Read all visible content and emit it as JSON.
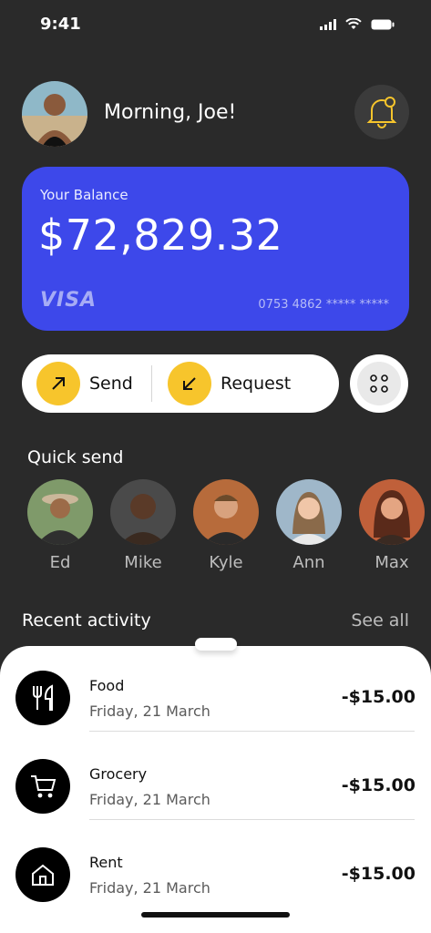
{
  "status": {
    "time": "9:41"
  },
  "header": {
    "greeting": "Morning, Joe!"
  },
  "balance": {
    "label": "Your Balance",
    "amount": "$72,829.32",
    "card_brand": "VISA",
    "card_number": "0753 4862 ***** *****"
  },
  "actions": {
    "send_label": "Send",
    "request_label": "Request"
  },
  "quick_send": {
    "title": "Quick send",
    "contacts": [
      {
        "name": "Ed"
      },
      {
        "name": "Mike"
      },
      {
        "name": "Kyle"
      },
      {
        "name": "Ann"
      },
      {
        "name": "Max"
      }
    ]
  },
  "recent": {
    "title": "Recent activity",
    "see_all": "See all",
    "items": [
      {
        "title": "Food",
        "date": "Friday, 21 March",
        "amount": "-$15.00",
        "icon": "fork-knife-icon"
      },
      {
        "title": "Grocery",
        "date": "Friday, 21 March",
        "amount": "-$15.00",
        "icon": "cart-icon"
      },
      {
        "title": "Rent",
        "date": "Friday, 21 March",
        "amount": "-$15.00",
        "icon": "house-icon"
      }
    ]
  },
  "colors": {
    "background": "#2a2a2a",
    "card": "#3d48ea",
    "accent": "#f7c52c"
  }
}
